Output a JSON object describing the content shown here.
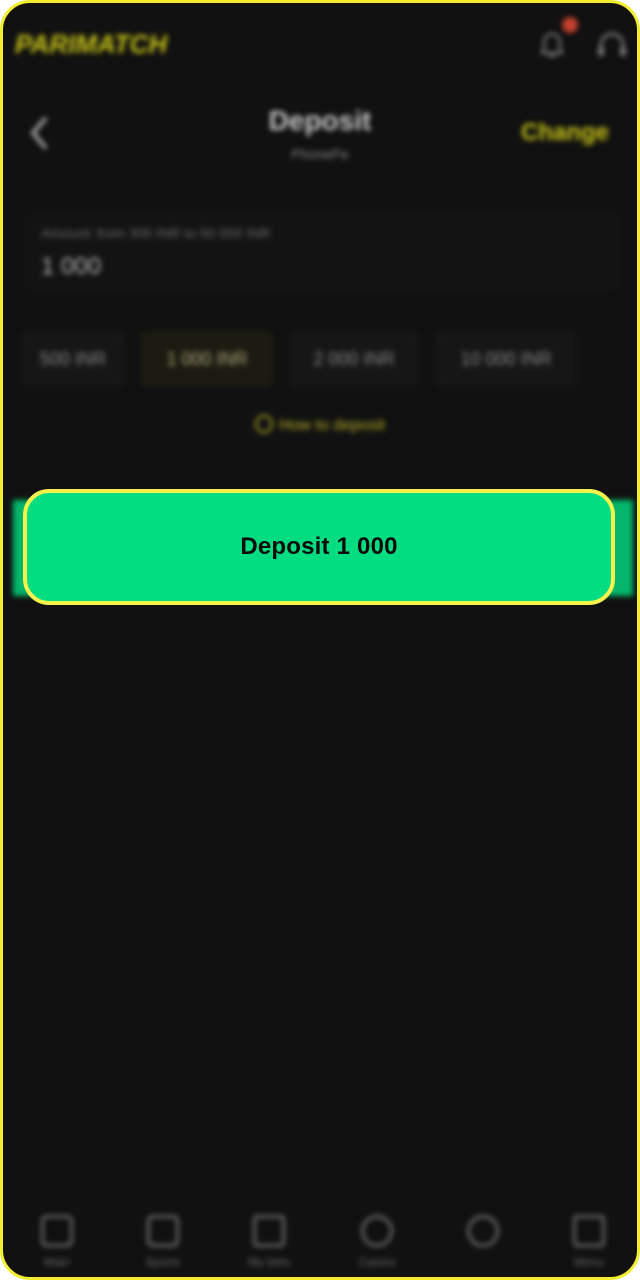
{
  "header": {
    "logo_text": "PARIMATCH",
    "notifications_icon": "bell-icon",
    "support_icon": "support-icon"
  },
  "page": {
    "title": "Deposit",
    "subtitle": "PhonePe",
    "change_label": "Change",
    "back_icon": "chevron-left-icon"
  },
  "amount": {
    "label": "Amount: from 300 INR to 50 000 INR",
    "value": "1 000"
  },
  "chips": [
    {
      "label": "500 INR"
    },
    {
      "label": "1 000 INR"
    },
    {
      "label": "2 000 INR"
    },
    {
      "label": "10 000 INR"
    }
  ],
  "how_to": {
    "label": "How to deposit"
  },
  "cta": {
    "label": "Deposit 1 000",
    "color": "#02dd82",
    "highlight_color": "#f5f24b"
  },
  "nav": [
    {
      "label": "Main"
    },
    {
      "label": "Sports"
    },
    {
      "label": "My bets"
    },
    {
      "label": "Casino"
    },
    {
      "label": ""
    },
    {
      "label": "Menu"
    }
  ],
  "colors": {
    "background": "#111111",
    "accent": "#e8e31a",
    "frame": "#f2ee2e"
  }
}
